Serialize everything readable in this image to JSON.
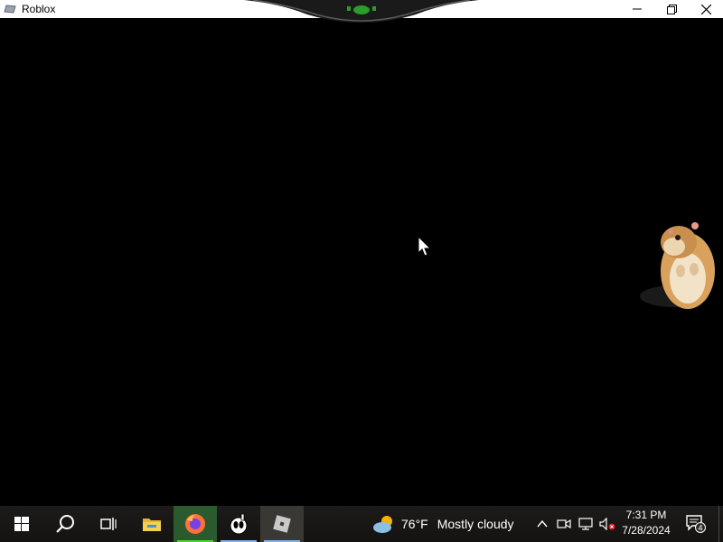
{
  "window": {
    "title": "Roblox",
    "buttons": [
      "minimize",
      "maximize",
      "close"
    ]
  },
  "taskbar": {
    "pinned": [
      {
        "icon": "windows-start-icon"
      },
      {
        "icon": "search-icon"
      },
      {
        "icon": "task-view-icon"
      },
      {
        "icon": "file-explorer-icon"
      },
      {
        "icon": "firefox-icon"
      },
      {
        "icon": "cuphead-icon"
      },
      {
        "icon": "roblox-icon"
      }
    ],
    "weather": {
      "temp": "76°F",
      "condition": "Mostly cloudy",
      "icon": "partly-cloudy-icon"
    },
    "tray_icons": [
      "chevron-up-icon",
      "meet-now-icon",
      "network-icon",
      "volume-muted-icon"
    ],
    "clock": {
      "time": "7:31 PM",
      "date": "7/28/2024"
    },
    "notifications": {
      "count": "4"
    }
  },
  "colors": {
    "accent": "#4cd137",
    "taskbar": "#1c1b19"
  }
}
